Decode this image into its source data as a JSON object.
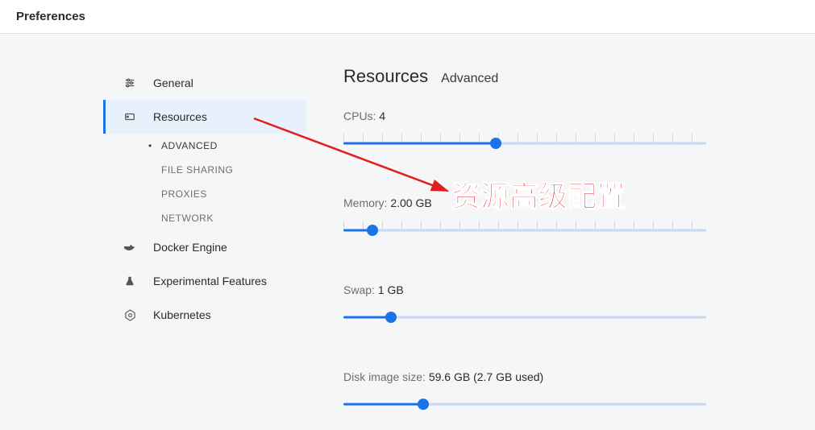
{
  "header": {
    "title": "Preferences"
  },
  "sidebar": {
    "items": [
      {
        "label": "General"
      },
      {
        "label": "Resources"
      },
      {
        "label": "Docker Engine"
      },
      {
        "label": "Experimental Features"
      },
      {
        "label": "Kubernetes"
      }
    ],
    "resourcesSub": [
      {
        "label": "ADVANCED"
      },
      {
        "label": "FILE SHARING"
      },
      {
        "label": "PROXIES"
      },
      {
        "label": "NETWORK"
      }
    ]
  },
  "content": {
    "title": "Resources",
    "subtitle": "Advanced",
    "cpus": {
      "label": "CPUs:",
      "value": "4",
      "pct": 42
    },
    "memory": {
      "label": "Memory:",
      "value": "2.00 GB",
      "pct": 8
    },
    "swap": {
      "label": "Swap:",
      "value": "1 GB",
      "pct": 13
    },
    "disk": {
      "label": "Disk image size:",
      "value": "59.6 GB (2.7 GB used)",
      "pct": 22
    }
  },
  "annotation": {
    "text": "资源高级配置"
  }
}
